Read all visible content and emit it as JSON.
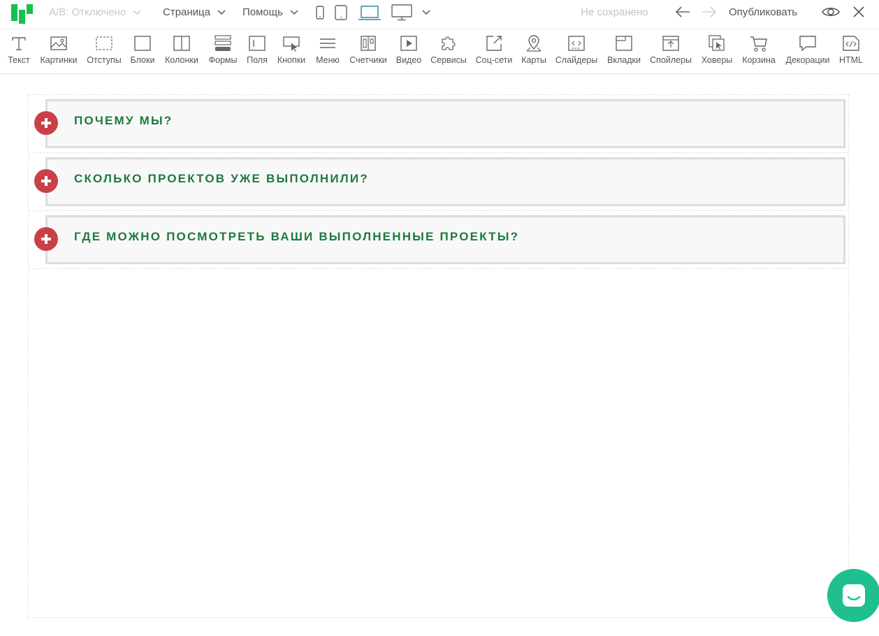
{
  "header": {
    "ab_label": "A/B: Отключено",
    "page_menu": "Страница",
    "help_menu": "Помощь",
    "status": "Не сохранено",
    "publish": "Опубликовать"
  },
  "toolbar": {
    "items": [
      {
        "label": "Текст",
        "icon": "text-icon"
      },
      {
        "label": "Картинки",
        "icon": "image-icon"
      },
      {
        "label": "Отступы",
        "icon": "spacing-icon"
      },
      {
        "label": "Блоки",
        "icon": "block-icon"
      },
      {
        "label": "Колонки",
        "icon": "columns-icon"
      },
      {
        "label": "Формы",
        "icon": "form-icon"
      },
      {
        "label": "Поля",
        "icon": "field-icon"
      },
      {
        "label": "Кнопки",
        "icon": "button-icon"
      },
      {
        "label": "Меню",
        "icon": "menu-icon"
      },
      {
        "label": "Счетчики",
        "icon": "counter-icon"
      },
      {
        "label": "Видео",
        "icon": "video-icon"
      },
      {
        "label": "Сервисы",
        "icon": "puzzle-icon"
      },
      {
        "label": "Соц-сети",
        "icon": "share-icon"
      },
      {
        "label": "Карты",
        "icon": "map-pin-icon"
      },
      {
        "label": "Слайдеры",
        "icon": "slider-icon"
      },
      {
        "label": "Вкладки",
        "icon": "tabs-icon"
      },
      {
        "label": "Спойлеры",
        "icon": "spoiler-icon"
      },
      {
        "label": "Ховеры",
        "icon": "hover-icon"
      },
      {
        "label": "Корзина",
        "icon": "cart-icon"
      },
      {
        "label": "Декорации",
        "icon": "decoration-icon"
      },
      {
        "label": "HTML",
        "icon": "html-icon"
      }
    ]
  },
  "accordion": {
    "items": [
      {
        "title": "ПОЧЕМУ МЫ?"
      },
      {
        "title": "СКОЛЬКО ПРОЕКТОВ УЖЕ ВЫПОЛНИЛИ?"
      },
      {
        "title": "ГДЕ МОЖНО ПОСМОТРЕТЬ ВАШИ ВЫПОЛНЕННЫЕ ПРОЕКТЫ?"
      }
    ]
  },
  "colors": {
    "accent_green": "#1d7a3c",
    "plus_red": "#c94048",
    "chat_green": "#1fbf8f",
    "logo_green": "#17c04f"
  }
}
